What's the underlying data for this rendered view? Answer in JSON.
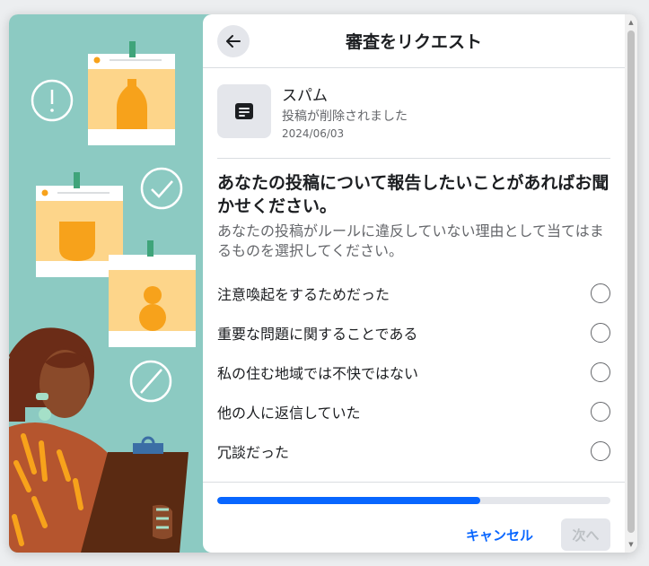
{
  "dialog": {
    "title": "審査をリクエスト"
  },
  "content": {
    "title": "スパム",
    "subtitle": "投稿が削除されました",
    "date": "2024/06/03"
  },
  "question": {
    "heading": "あなたの投稿について報告したいことがあればお聞かせください。",
    "description": "あなたの投稿がルールに違反していない理由として当てはまるものを選択してください。"
  },
  "options": [
    {
      "label": "注意喚起をするためだった"
    },
    {
      "label": "重要な問題に関することである"
    },
    {
      "label": "私の住む地域では不快ではない"
    },
    {
      "label": "他の人に返信していた"
    },
    {
      "label": "冗談だった"
    }
  ],
  "footer": {
    "progress": 0.67,
    "cancel_label": "キャンセル",
    "next_label": "次へ"
  },
  "colors": {
    "accent": "#0866ff",
    "illustration_bg": "#8ccac2"
  }
}
